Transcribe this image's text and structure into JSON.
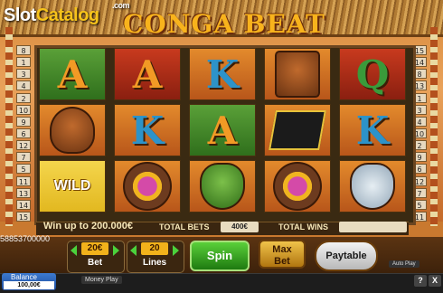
{
  "site_logo": {
    "part1": "Slot",
    "part2": "Catalog",
    "suffix": ".com"
  },
  "game_title": "CONGA BEAT",
  "reels": [
    [
      "A",
      "mask-brown",
      "WILD"
    ],
    [
      "A",
      "K",
      "mask-purple"
    ],
    [
      "K",
      "A",
      "mask-green"
    ],
    [
      "mask-tiki",
      "mask-black",
      "mask-purple"
    ],
    [
      "Q",
      "K",
      "mask-white"
    ]
  ],
  "paylines_left": [
    "8",
    "1",
    "3",
    "4",
    "2",
    "10",
    "9",
    "6",
    "12",
    "7",
    "5",
    "11",
    "13",
    "14",
    "15"
  ],
  "paylines_right": [
    "15",
    "14",
    "8",
    "13",
    "1",
    "3",
    "4",
    "10",
    "2",
    "9",
    "6",
    "12",
    "7",
    "5",
    "11"
  ],
  "info": {
    "win_up_to": "Win up to 200.000€",
    "total_bets_label": "TOTAL BETS",
    "total_bets_value": "400€",
    "total_wins_label": "TOTAL WINS",
    "total_wins_value": ""
  },
  "id_number": "58853700000",
  "controls": {
    "bet_value": "20€",
    "bet_label": "Bet",
    "lines_value": "20",
    "lines_label": "Lines",
    "spin_label": "Spin",
    "maxbet_line1": "Max",
    "maxbet_line2": "Bet",
    "paytable_label": "Paytable"
  },
  "bottom": {
    "balance_label": "Balance",
    "balance_value": "100,00€",
    "money_play": "Money Play",
    "auto_play": "Auto Play",
    "help": "?",
    "close": "X"
  }
}
